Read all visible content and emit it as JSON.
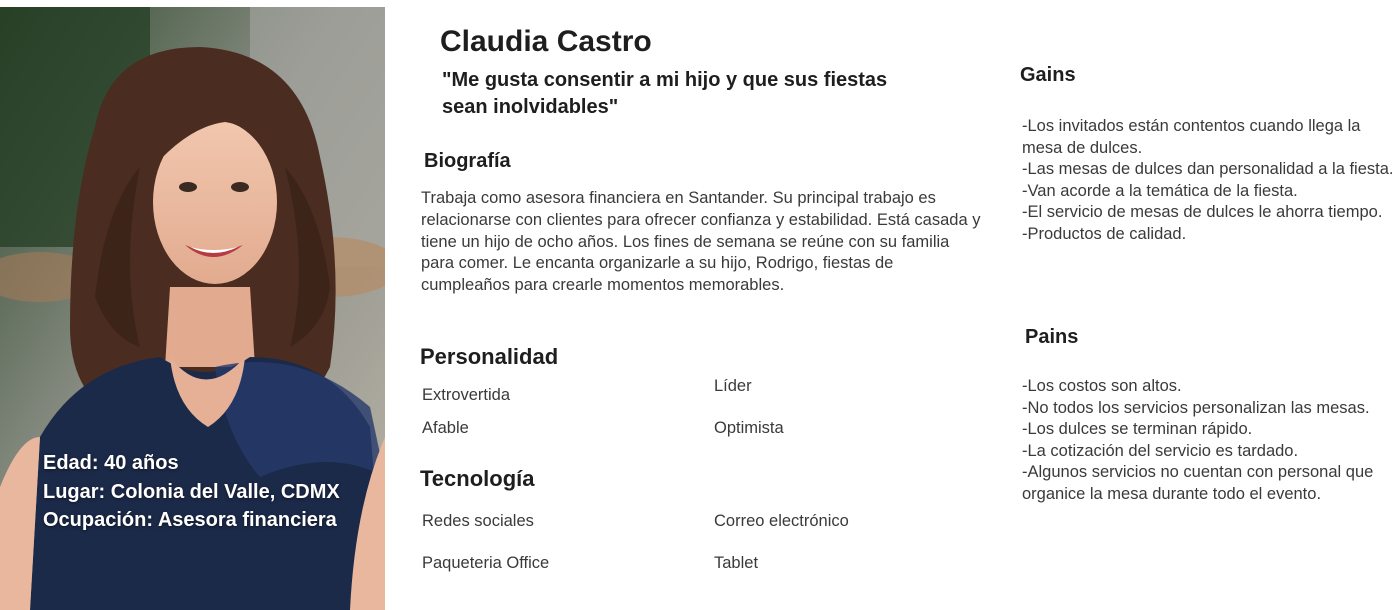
{
  "profile": {
    "name": "Claudia Castro",
    "quote": "\"Me gusta consentir a mi hijo y que sus fiestas sean inolvidables\"",
    "age": "Edad:  40 años",
    "location": "Lugar: Colonia del Valle, CDMX",
    "occupation": "Ocupación: Asesora financiera"
  },
  "biography": {
    "heading": "Biografía",
    "text": "Trabaja como asesora financiera en Santander. Su principal trabajo es relacionarse  con clientes para ofrecer confianza y estabilidad. Está casada y tiene un hijo de ocho años. Los fines de semana se reúne con su familia para comer. Le encanta organizarle a su hijo, Rodrigo, fiestas de cumpleaños para crearle momentos memorables."
  },
  "personality": {
    "heading": "Personalidad",
    "items": [
      "Extrovertida",
      "Líder",
      "Afable",
      "Optimista"
    ]
  },
  "technology": {
    "heading": "Tecnología",
    "items": [
      "Redes sociales",
      "Correo electrónico",
      "Paqueteria Office",
      "Tablet"
    ]
  },
  "gains": {
    "heading": "Gains",
    "items": [
      "-Los invitados están contentos cuando llega la mesa de dulces.",
      "-Las mesas de dulces dan personalidad a la fiesta.",
      "-Van acorde a la temática de la fiesta.",
      "-El servicio de mesas de dulces le ahorra tiempo.",
      "-Productos de calidad."
    ]
  },
  "pains": {
    "heading": "Pains",
    "items": [
      "-Los costos son altos.",
      "-No todos los servicios personalizan las mesas.",
      "-Los dulces se terminan rápido.",
      "-La cotización del servicio es tardado.",
      "-Algunos servicios no cuentan con personal que organice la mesa durante todo el evento."
    ]
  },
  "colors": {
    "text": "#3a3a3a",
    "heading": "#1e1e1e",
    "dress": "#1c2a4a",
    "hair": "#4a2c20"
  }
}
